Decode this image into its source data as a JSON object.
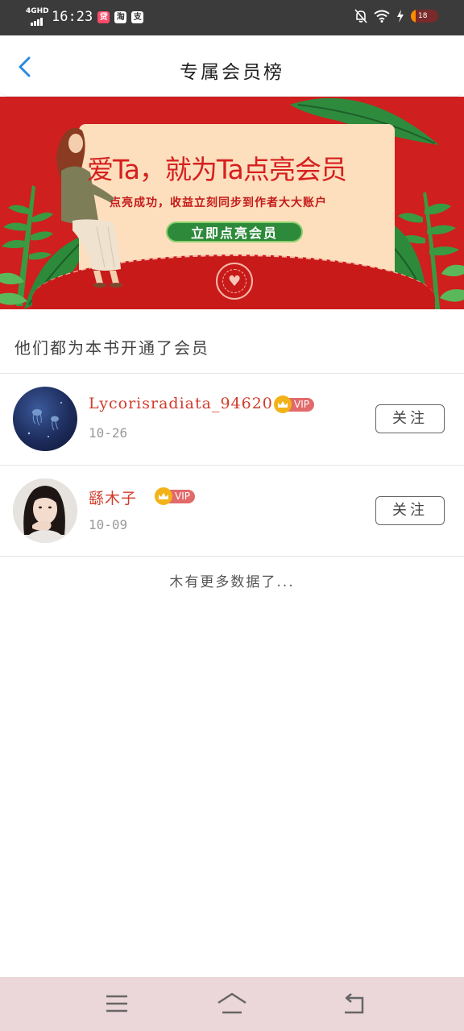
{
  "status_bar": {
    "network": "4GHD",
    "time": "16:23",
    "apps": [
      {
        "icon": "notification-app-icon",
        "glyph": "贷",
        "color": "#ff4a6b"
      },
      {
        "icon": "taobao-icon",
        "glyph": "淘",
        "color": "#ffffff"
      },
      {
        "icon": "alipay-icon",
        "glyph": "支",
        "color": "#ffffff"
      }
    ],
    "battery_level": "18"
  },
  "header": {
    "title": "专属会员榜",
    "back_icon": "chevron-left-icon",
    "accent": "#2a8ae0"
  },
  "banner": {
    "heading": "爱Ta，就为Ta点亮会员",
    "subtitle": "点亮成功，收益立刻同步到作者大大账户",
    "button_label": "立即点亮会员",
    "colors": {
      "background": "#cf1f1f",
      "card": "#fddfbd",
      "button": "#2d8a3a"
    }
  },
  "section": {
    "title": "他们都为本书开通了会员"
  },
  "members": [
    {
      "name": "Lycorisradiata_94620",
      "badge": "VIP",
      "date": "10-26",
      "follow_label": "关注",
      "avatar": "avatar-jellyfish"
    },
    {
      "name": "繇木子",
      "badge": "VIP",
      "date": "10-09",
      "follow_label": "关注",
      "avatar": "avatar-woman"
    }
  ],
  "footer_text": "木有更多数据了...",
  "nav_bar": {
    "buttons": [
      "menu-icon",
      "home-icon",
      "back-icon"
    ]
  }
}
